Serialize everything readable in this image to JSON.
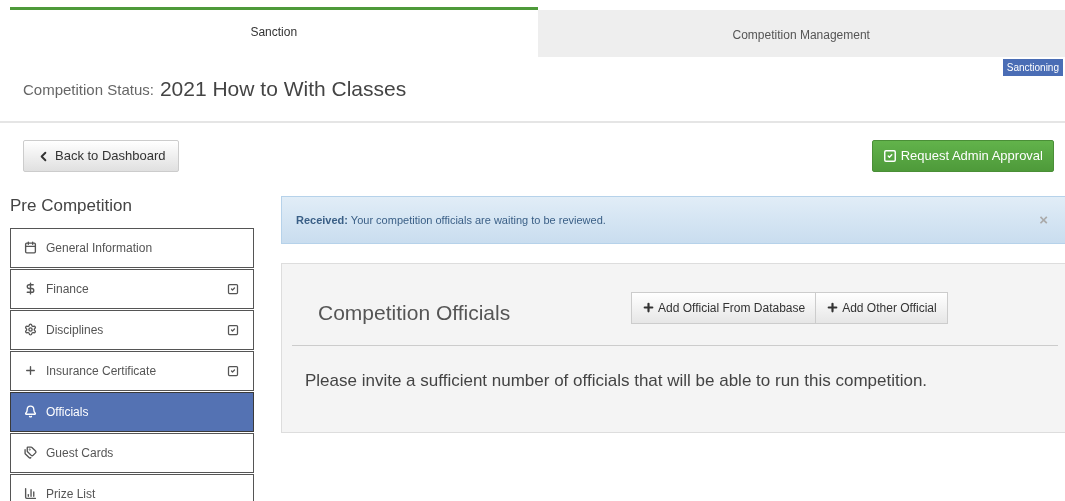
{
  "tabs": [
    {
      "label": "Sanction",
      "selected": true
    },
    {
      "label": "Competition Management",
      "selected": false
    }
  ],
  "status": {
    "label": "Competition Status:",
    "title": "2021 How to With Classes",
    "badge": "Sanctioning"
  },
  "back_button": "Back to Dashboard",
  "approval_button": "Request Admin Approval",
  "sidebar": {
    "heading": "Pre Competition",
    "items": [
      {
        "label": "General Information",
        "completed": false,
        "selected": false
      },
      {
        "label": "Finance",
        "completed": true,
        "selected": false
      },
      {
        "label": "Disciplines",
        "completed": true,
        "selected": false
      },
      {
        "label": "Insurance Certificate",
        "completed": true,
        "selected": false
      },
      {
        "label": "Officials",
        "completed": false,
        "selected": true
      },
      {
        "label": "Guest Cards",
        "completed": false,
        "selected": false
      },
      {
        "label": "Prize List",
        "completed": false,
        "selected": false
      }
    ]
  },
  "alert": {
    "message": "**Received:** Your competition officials are waiting to be reviewed.",
    "close": "×"
  },
  "panel": {
    "title": "Competition Officials",
    "buttons": [
      "Add Official From Database",
      "Add Other Official"
    ],
    "message": "Please invite a sufficient number of officials that will be able to run this competition."
  }
}
